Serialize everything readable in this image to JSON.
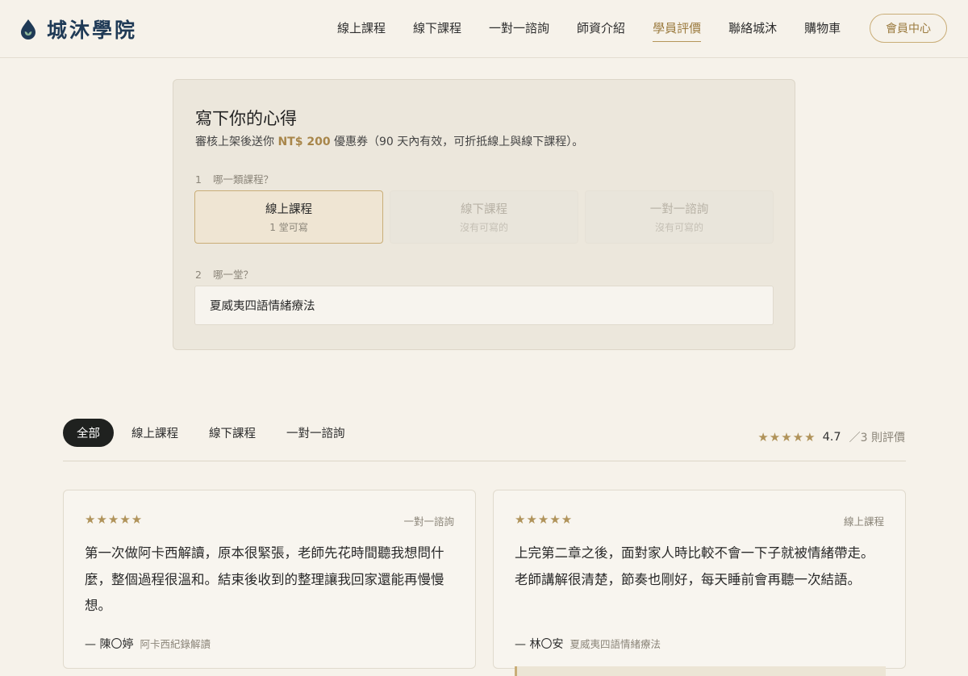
{
  "brand": {
    "name": "城沐學院"
  },
  "nav": {
    "items": [
      "線上課程",
      "線下課程",
      "一對一諮詢",
      "師資介紹",
      "學員評價",
      "聯絡城沐",
      "購物車"
    ],
    "active_index": 4,
    "member_label": "會員中心"
  },
  "form": {
    "title": "寫下你的心得",
    "subtitle_before": "審核上架後送你 ",
    "subtitle_amount": "NT$ 200",
    "subtitle_after": " 優惠券（90 天內有效，可折抵線上與線下課程）。",
    "step1": {
      "num": "1",
      "label": "哪一類課程？"
    },
    "step2": {
      "num": "2",
      "label": "哪一堂？"
    },
    "choices": [
      {
        "label": "線上課程",
        "sub": "1 堂可寫",
        "selected": true
      },
      {
        "label": "線下課程",
        "sub": "沒有可寫的",
        "selected": false
      },
      {
        "label": "一對一諮詢",
        "sub": "沒有可寫的",
        "selected": false
      }
    ],
    "lesson_value": "夏威夷四語情緒療法"
  },
  "filters": {
    "tabs": [
      "全部",
      "線上課程",
      "線下課程",
      "一對一諮詢"
    ],
    "active_index": 0
  },
  "summary": {
    "stars": "★★★★★",
    "average": "4.7",
    "count_text": "／3 則評價",
    "rating_value": 4.7
  },
  "reviews": [
    {
      "stars": "★★★★★",
      "category": "一對一諮詢",
      "text": "第一次做阿卡西解讀，原本很緊張，老師先花時間聽我想問什麼，整個過程很溫和。結束後收到的整理讓我回家還能再慢慢想。",
      "author": "— 陳〇婷",
      "course": "阿卡西紀錄解讀"
    },
    {
      "stars": "★★★★★",
      "category": "線上課程",
      "text": "上完第二章之後，面對家人時比較不會一下子就被情緒帶走。老師講解很清楚，節奏也剛好，每天睡前會再聽一次結語。",
      "author": "— 林〇安",
      "course": "夏威夷四語情緒療法"
    }
  ],
  "colors": {
    "background": "#f6f2ea",
    "brand_navy": "#1f3a56",
    "accent_gold": "#b0935a",
    "tab_active_bg": "#1f211f"
  },
  "icons": {
    "logo": "drop-leaf-icon",
    "star": "star-icon"
  }
}
